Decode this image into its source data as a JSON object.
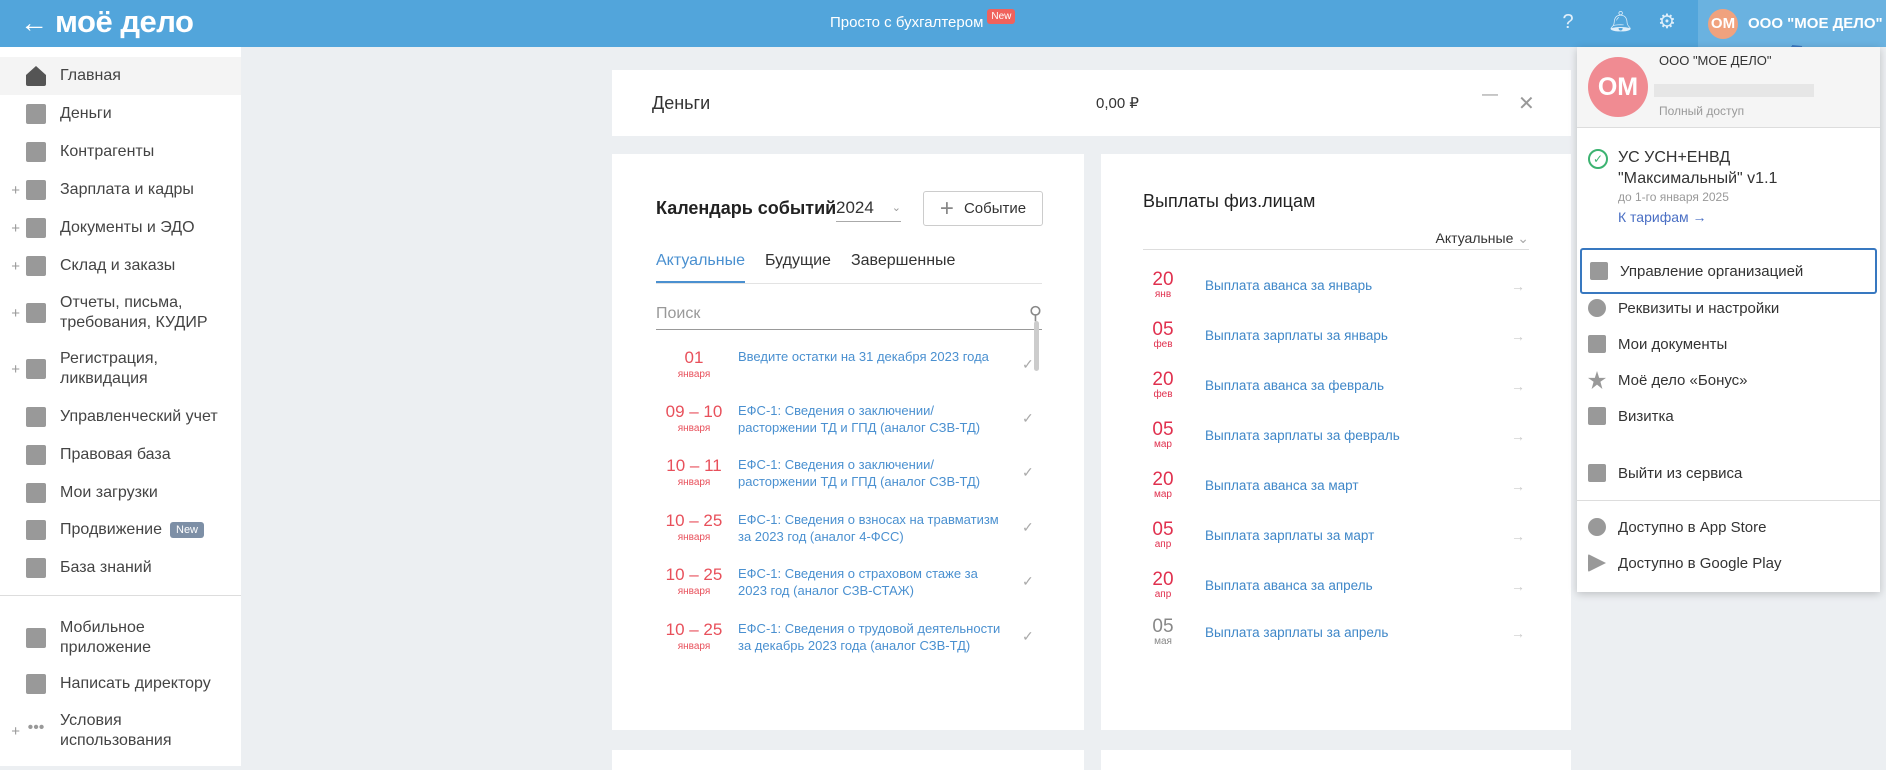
{
  "header": {
    "logo": "моё дело",
    "center_link": "Просто с бухгалтером",
    "new_badge": "New",
    "account_initials": "ОМ",
    "account_name": "ООО \"МОЕ ДЕЛО\""
  },
  "sidebar": {
    "items": [
      {
        "label": "Главная",
        "expandable": false
      },
      {
        "label": "Деньги",
        "expandable": false
      },
      {
        "label": "Контрагенты",
        "expandable": false
      },
      {
        "label": "Зарплата и кадры",
        "expandable": true
      },
      {
        "label": "Документы и ЭДО",
        "expandable": true
      },
      {
        "label": "Склад и заказы",
        "expandable": true
      },
      {
        "label": "Отчеты, письма, требования, КУДИР",
        "expandable": true
      },
      {
        "label": "Регистрация, ликвидация",
        "expandable": true
      },
      {
        "label": "Управленческий учет",
        "expandable": false
      },
      {
        "label": "Правовая база",
        "expandable": false
      },
      {
        "label": "Мои загрузки",
        "expandable": false
      },
      {
        "label": "Продвижение",
        "badge": "New",
        "expandable": false
      },
      {
        "label": "База знаний",
        "expandable": false
      }
    ],
    "bottom": [
      {
        "label": "Мобильное приложение"
      },
      {
        "label": "Написать директору"
      },
      {
        "label": "Условия использования"
      }
    ]
  },
  "money": {
    "title": "Деньги",
    "amount": "0,00 ₽"
  },
  "calendar": {
    "title": "Календарь событий",
    "year": "2024",
    "add_button": "Событие",
    "tabs": [
      "Актуальные",
      "Будущие",
      "Завершенные"
    ],
    "search_placeholder": "Поиск",
    "events": [
      {
        "date": "01",
        "month": "января",
        "text": "Введите остатки на 31 декабря 2023 года"
      },
      {
        "date": "09 – 10",
        "month": "января",
        "text": "ЕФС-1: Сведения о заключении/ расторжении ТД и ГПД (аналог СЗВ-ТД)"
      },
      {
        "date": "10 – 11",
        "month": "января",
        "text": "ЕФС-1: Сведения о заключении/ расторжении ТД и ГПД (аналог СЗВ-ТД)"
      },
      {
        "date": "10 – 25",
        "month": "января",
        "text": "ЕФС-1: Сведения о взносах на травматизм за 2023 год (аналог 4-ФСС)"
      },
      {
        "date": "10 – 25",
        "month": "января",
        "text": "ЕФС-1: Сведения о страховом стаже за 2023 год (аналог СЗВ-СТАЖ)"
      },
      {
        "date": "10 – 25",
        "month": "января",
        "text": "ЕФС-1: Сведения о трудовой деятельности за декабрь 2023 года (аналог СЗВ-ТД)"
      }
    ]
  },
  "payments": {
    "title": "Выплаты физ.лицам",
    "filter": "Актуальные",
    "items": [
      {
        "day": "20",
        "month": "янв",
        "text": "Выплата аванса за январь"
      },
      {
        "day": "05",
        "month": "фев",
        "text": "Выплата зарплаты за январь"
      },
      {
        "day": "20",
        "month": "фев",
        "text": "Выплата аванса за февраль"
      },
      {
        "day": "05",
        "month": "мар",
        "text": "Выплата зарплаты за февраль"
      },
      {
        "day": "20",
        "month": "мар",
        "text": "Выплата аванса за март"
      },
      {
        "day": "05",
        "month": "апр",
        "text": "Выплата зарплаты за март"
      },
      {
        "day": "20",
        "month": "апр",
        "text": "Выплата аванса за апрель"
      },
      {
        "day": "05",
        "month": "мая",
        "text": "Выплата зарплаты за апрель"
      }
    ]
  },
  "account_menu": {
    "initials": "ОМ",
    "org": "ООО \"МОЕ ДЕЛО\"",
    "access": "Полный доступ",
    "tariff": "УС УСН+ЕНВД \"Максимальный\" v1.1",
    "tariff_until": "до 1-го января 2025",
    "tariff_link": "К тарифам →",
    "items": [
      "Управление организацией",
      "Реквизиты и настройки",
      "Мои документы",
      "Моё дело «Бонус»",
      "Визитка",
      "Выйти из сервиса",
      "Доступно в App Store",
      "Доступно в Google Play"
    ]
  },
  "colors": {
    "header": "#52a5db",
    "accent": "#4a90d0",
    "date_red": "#e8505b"
  }
}
